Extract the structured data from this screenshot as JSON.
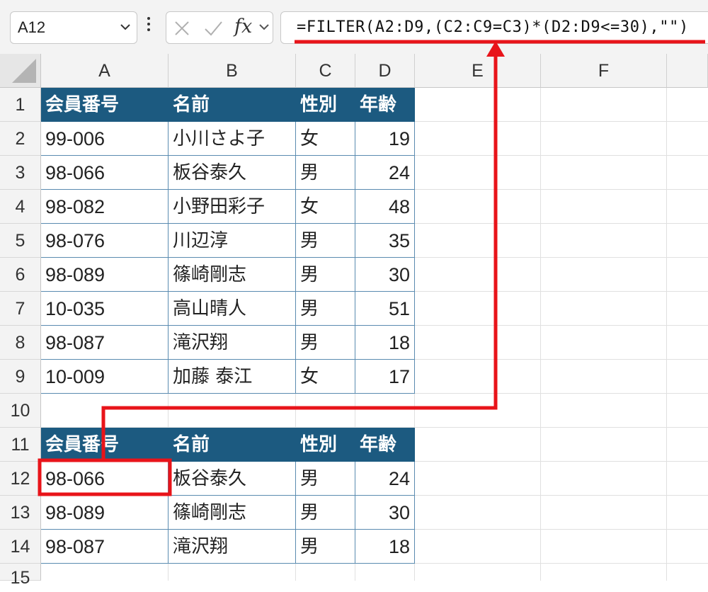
{
  "formula_bar": {
    "name_box": "A12",
    "fx_label": "fx",
    "formula": "=FILTER(A2:D9,(C2:C9=C3)*(D2:D9<=30),\"\")"
  },
  "columns": [
    "A",
    "B",
    "C",
    "D",
    "E",
    "F"
  ],
  "rows": [
    "1",
    "2",
    "3",
    "4",
    "5",
    "6",
    "7",
    "8",
    "9",
    "10",
    "11",
    "12",
    "13",
    "14",
    "15"
  ],
  "table1": {
    "headers": [
      "会員番号",
      "名前",
      "性別",
      "年齢"
    ],
    "rows": [
      [
        "99-006",
        "小川さよ子",
        "女",
        "19"
      ],
      [
        "98-066",
        "板谷泰久",
        "男",
        "24"
      ],
      [
        "98-082",
        "小野田彩子",
        "女",
        "48"
      ],
      [
        "98-076",
        "川辺淳",
        "男",
        "35"
      ],
      [
        "98-089",
        "篠崎剛志",
        "男",
        "30"
      ],
      [
        "10-035",
        "高山晴人",
        "男",
        "51"
      ],
      [
        "98-087",
        "滝沢翔",
        "男",
        "18"
      ],
      [
        "10-009",
        "加藤 泰江",
        "女",
        "17"
      ]
    ]
  },
  "table2": {
    "headers": [
      "会員番号",
      "名前",
      "性別",
      "年齢"
    ],
    "rows": [
      [
        "98-066",
        "板谷泰久",
        "男",
        "24"
      ],
      [
        "98-089",
        "篠崎剛志",
        "男",
        "30"
      ],
      [
        "98-087",
        "滝沢翔",
        "男",
        "18"
      ]
    ]
  },
  "colors": {
    "header_fill": "#1c5a80",
    "annotation": "#e8141a"
  }
}
